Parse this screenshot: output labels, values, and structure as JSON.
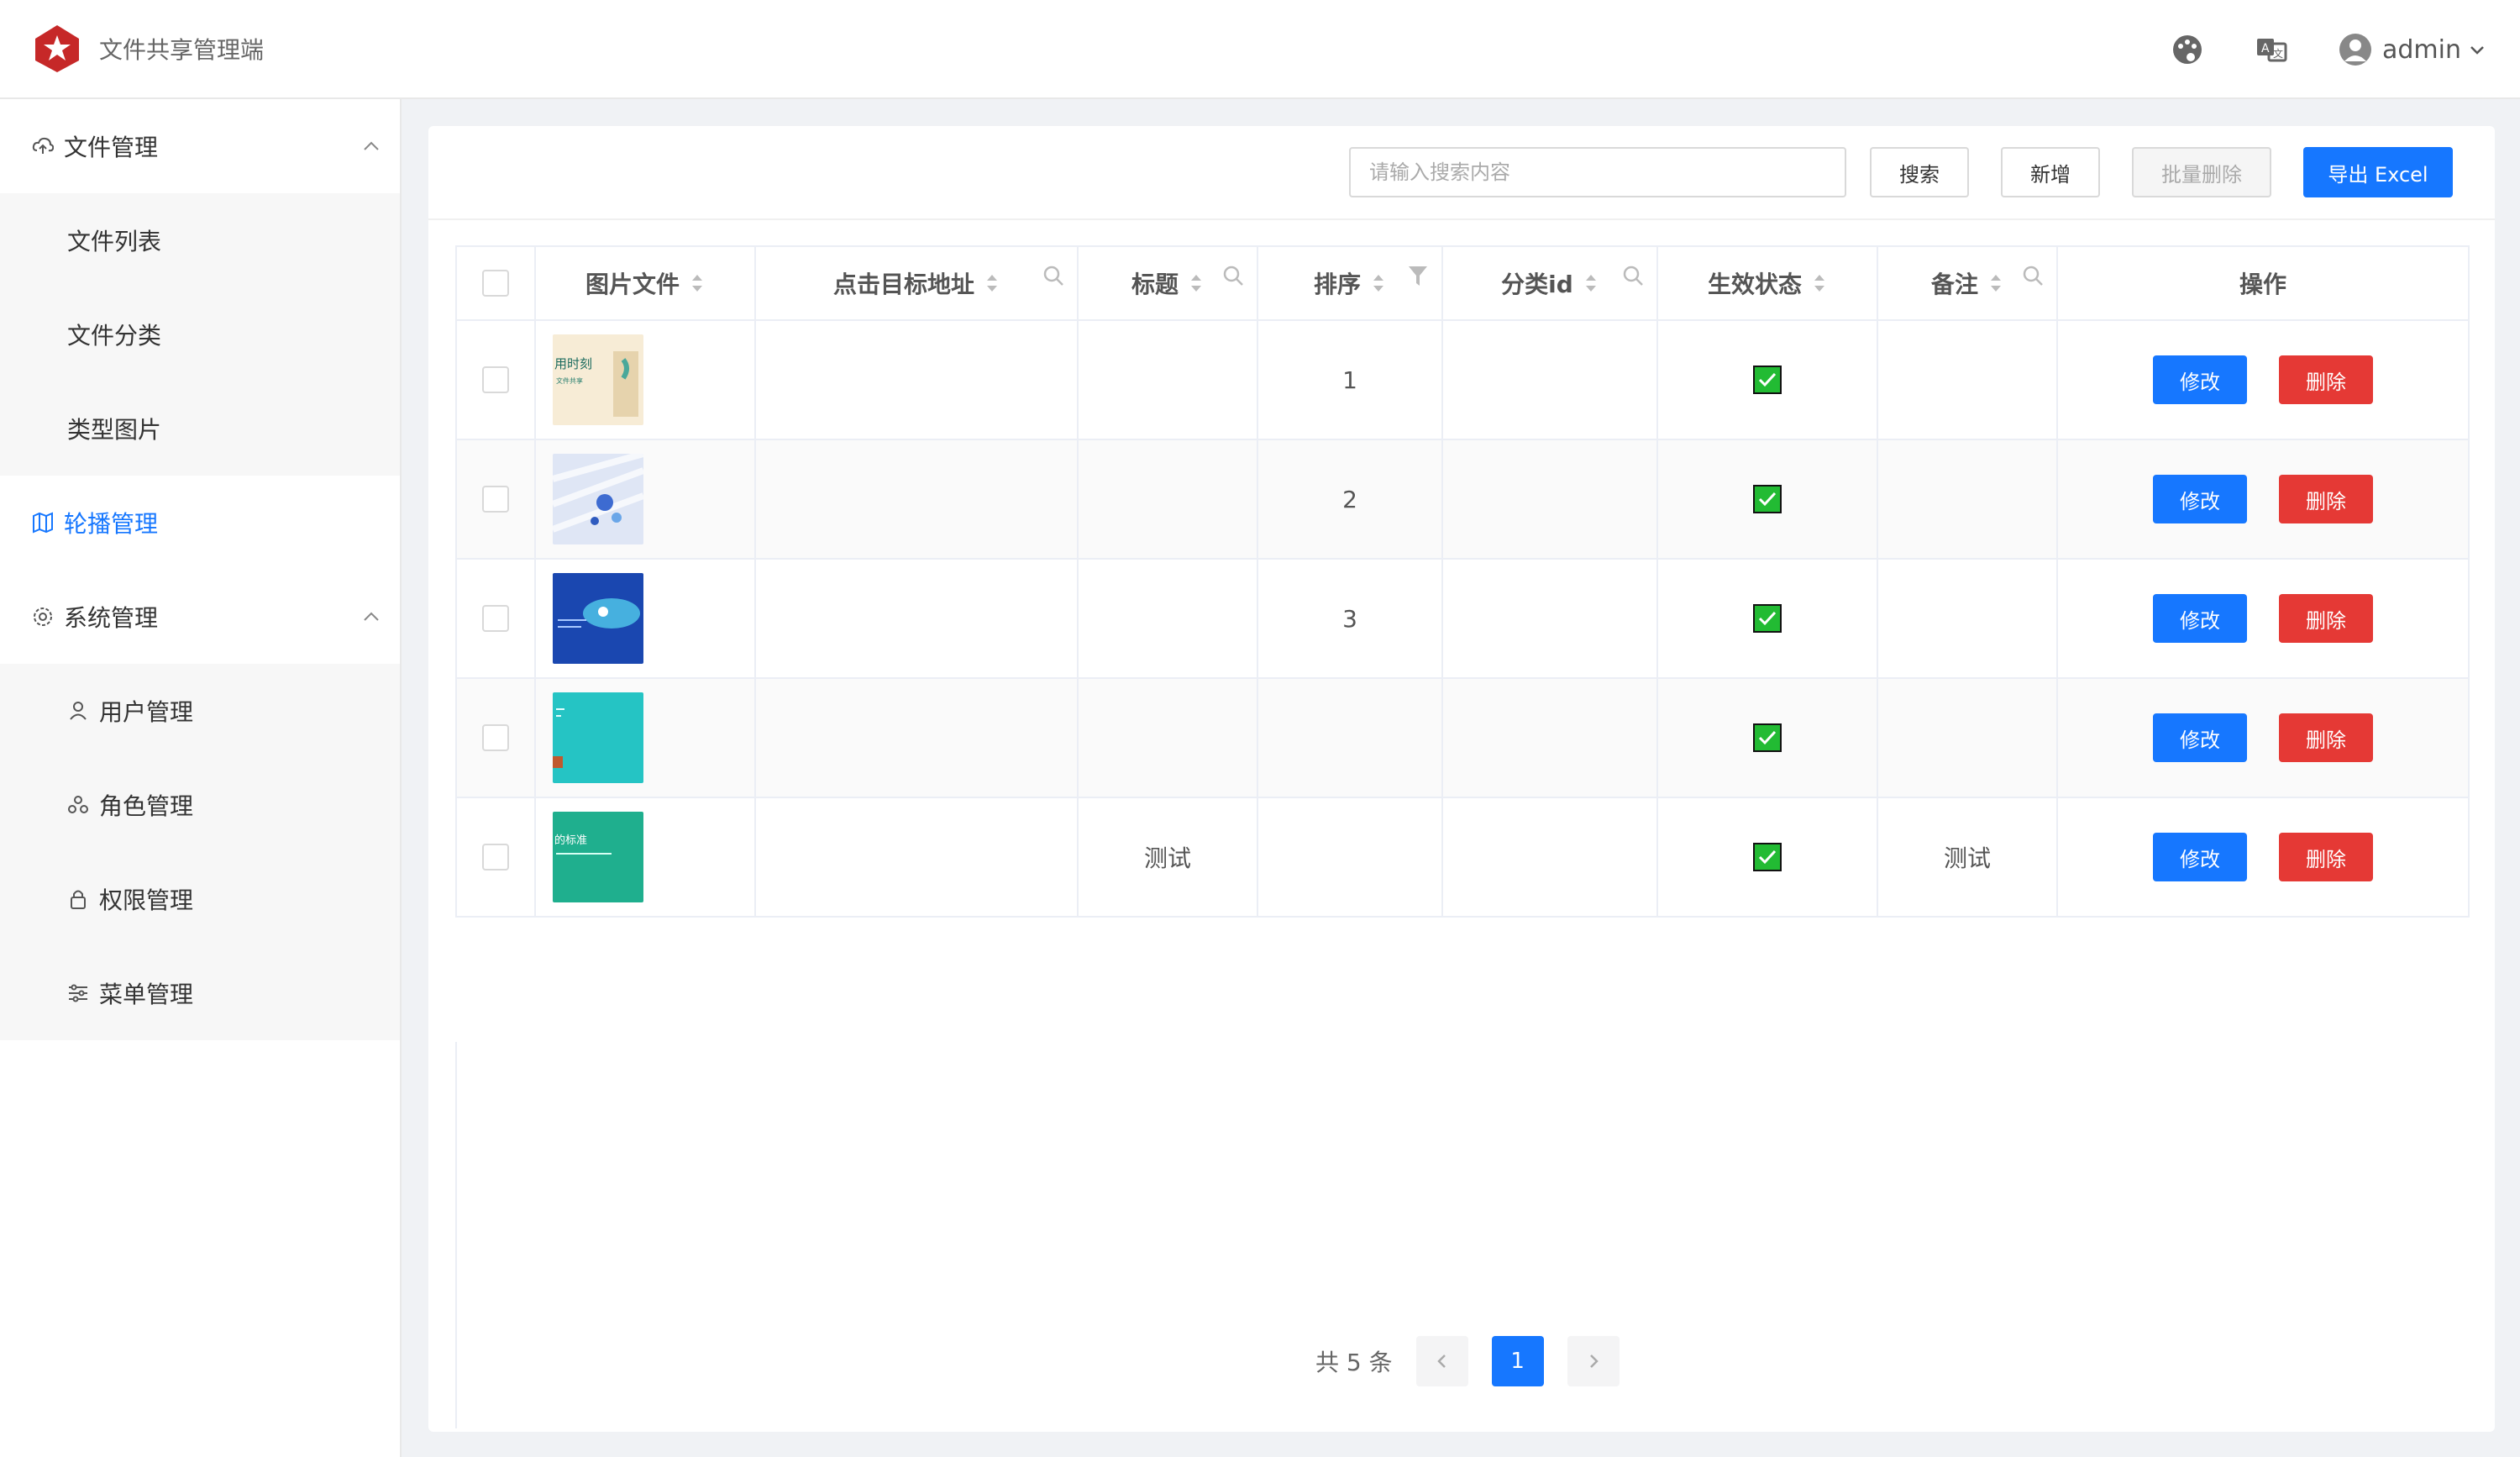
{
  "app": {
    "title": "文件共享管理端"
  },
  "header": {
    "user_name": "admin"
  },
  "sidebar": {
    "groups": [
      {
        "label": "文件管理",
        "children": [
          "文件列表",
          "文件分类",
          "类型图片"
        ]
      },
      {
        "label": "轮播管理"
      },
      {
        "label": "系统管理",
        "children": [
          "用户管理",
          "角色管理",
          "权限管理",
          "菜单管理"
        ]
      }
    ],
    "active": "轮播管理"
  },
  "toolbar": {
    "search_placeholder": "请输入搜索内容",
    "search_value": "",
    "search_label": "搜索",
    "add_label": "新增",
    "batch_delete_label": "批量删除",
    "export_label": "导出 Excel"
  },
  "table": {
    "columns": [
      "图片文件",
      "点击目标地址",
      "标题",
      "排序",
      "分类id",
      "生效状态",
      "备注",
      "操作"
    ],
    "rows": [
      {
        "url": "",
        "title": "",
        "sort": "1",
        "category": "",
        "active": true,
        "remark": "",
        "thumb_text": "用时刻"
      },
      {
        "url": "",
        "title": "",
        "sort": "2",
        "category": "",
        "active": true,
        "remark": "",
        "thumb_text": ""
      },
      {
        "url": "",
        "title": "",
        "sort": "3",
        "category": "",
        "active": true,
        "remark": "",
        "thumb_text": ""
      },
      {
        "url": "",
        "title": "",
        "sort": "",
        "category": "",
        "active": true,
        "remark": "",
        "thumb_text": ""
      },
      {
        "url": "",
        "title": "测试",
        "sort": "",
        "category": "",
        "active": true,
        "remark": "测试",
        "thumb_text": "的标准"
      }
    ],
    "edit_label": "修改",
    "delete_label": "删除"
  },
  "pagination": {
    "total_text": "共 5 条",
    "current_page": "1"
  },
  "colors": {
    "primary": "#1677ff",
    "danger": "#e53935",
    "status_green": "#22bb33"
  }
}
